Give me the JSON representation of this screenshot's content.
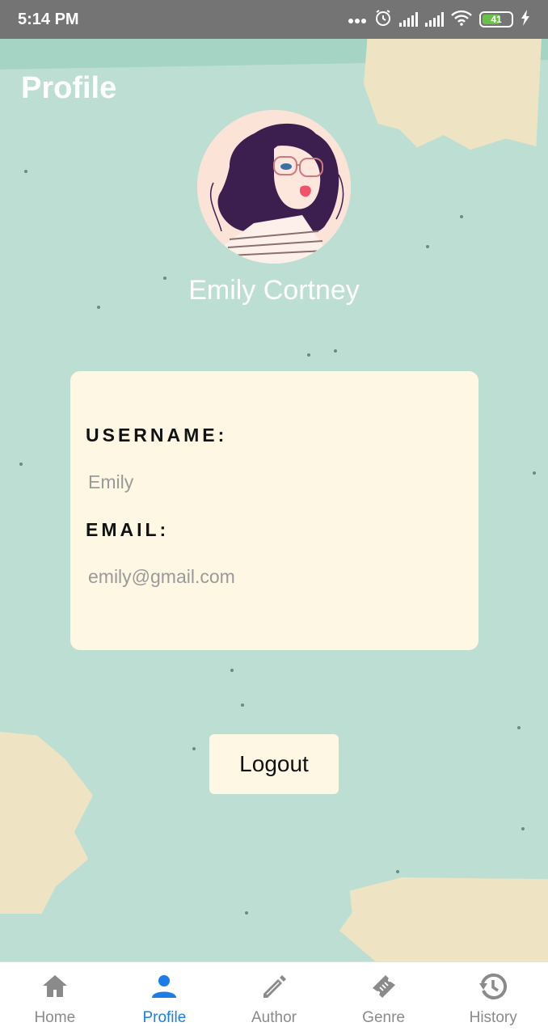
{
  "status_bar": {
    "time": "5:14 PM",
    "battery": "41",
    "icons": [
      "more-dots-icon",
      "alarm-icon",
      "signal-icon",
      "signal-icon",
      "wifi-icon",
      "battery-icon",
      "charging-icon"
    ]
  },
  "header": {
    "title": "Profile"
  },
  "profile": {
    "avatar": "woman-with-glasses-illustration",
    "name": "Emily Cortney"
  },
  "info_card": {
    "username_label": "USERNAME:",
    "username_value": "Emily",
    "email_label": "EMAIL:",
    "email_value": "emily@gmail.com"
  },
  "actions": {
    "logout_label": "Logout"
  },
  "bottom_nav": {
    "items": [
      {
        "label": "Home",
        "icon": "home-icon",
        "active": false
      },
      {
        "label": "Profile",
        "icon": "person-icon",
        "active": true
      },
      {
        "label": "Author",
        "icon": "pencil-icon",
        "active": false
      },
      {
        "label": "Genre",
        "icon": "ticket-icon",
        "active": false
      },
      {
        "label": "History",
        "icon": "history-icon",
        "active": false
      }
    ]
  },
  "colors": {
    "background": "#bddfd3",
    "card": "#fdf7e3",
    "nav_active": "#1a7ee6",
    "nav_inactive": "#8a8a8a",
    "status_bar": "#747474"
  }
}
